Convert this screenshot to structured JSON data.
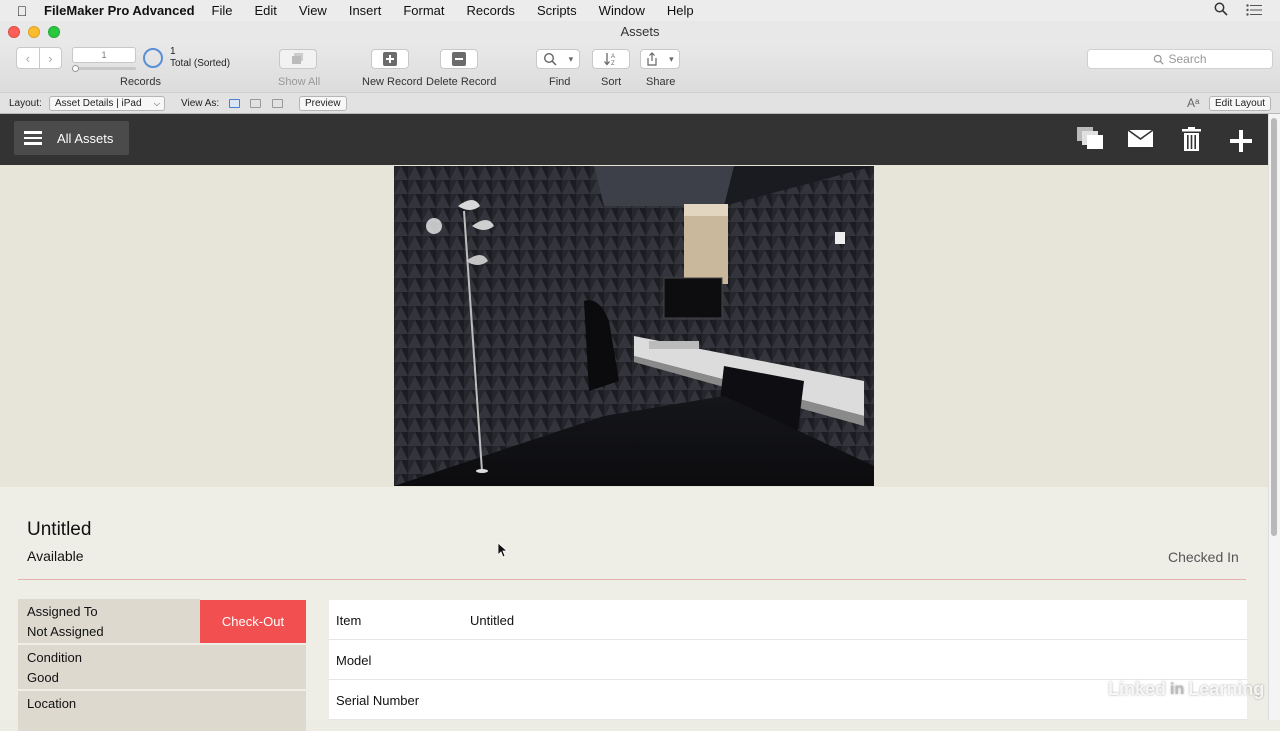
{
  "menubar": {
    "apple_icon": "apple-logo-icon",
    "app_name": "FileMaker Pro Advanced",
    "items": [
      "File",
      "Edit",
      "View",
      "Insert",
      "Format",
      "Records",
      "Scripts",
      "Window",
      "Help"
    ]
  },
  "window": {
    "title": "Assets"
  },
  "toolbar": {
    "record_number": "1",
    "records_label": "Records",
    "total_count": "1",
    "total_status": "Total (Sorted)",
    "show_all_label": "Show All",
    "new_record_label": "New Record",
    "delete_record_label": "Delete Record",
    "find_label": "Find",
    "sort_label": "Sort",
    "share_label": "Share",
    "search_placeholder": "Search"
  },
  "layoutbar": {
    "layout_label": "Layout:",
    "layout_value": "Asset Details | iPad",
    "view_as_label": "View As:",
    "preview_label": "Preview",
    "edit_layout_label": "Edit Layout"
  },
  "header": {
    "list_button_label": "All Assets",
    "actions": [
      "duplicate-icon",
      "email-icon",
      "trash-icon",
      "add-icon"
    ]
  },
  "photo": {
    "dots_count": 5,
    "active_dot": 0
  },
  "asset": {
    "title": "Untitled",
    "availability": "Available",
    "status": "Checked In",
    "assigned_to_label": "Assigned To",
    "assigned_to_value": "Not Assigned",
    "checkout_label": "Check-Out",
    "condition_label": "Condition",
    "condition_value": "Good",
    "location_label": "Location",
    "fields": [
      {
        "label": "Item",
        "value": "Untitled"
      },
      {
        "label": "Model",
        "value": ""
      },
      {
        "label": "Serial Number",
        "value": ""
      }
    ]
  },
  "watermark": {
    "text_left": "Linked",
    "text_in": "in",
    "text_right": "Learning"
  },
  "colors": {
    "header_bg": "#333333",
    "checkout_bg": "#f25050",
    "content_bg": "#e7e4da",
    "accent_blue": "#5a8fd6"
  }
}
